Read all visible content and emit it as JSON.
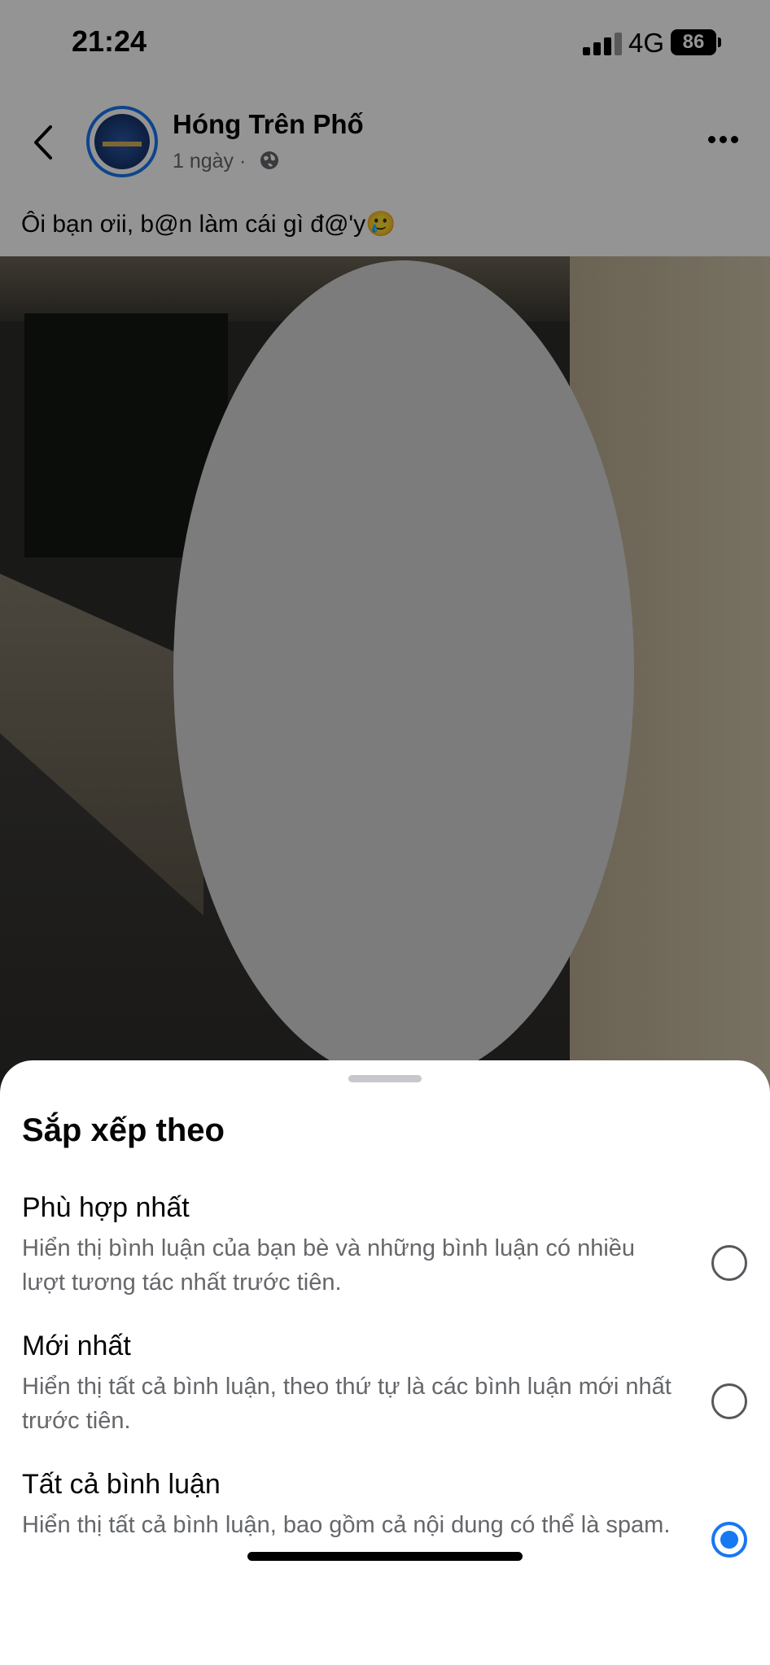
{
  "status_bar": {
    "time": "21:24",
    "network": "4G",
    "battery": "86"
  },
  "post": {
    "page_name": "Hóng Trên Phố",
    "time_ago": "1 ngày",
    "separator": "·",
    "caption": "Ôi bạn ơii, b@n làm cái gì đ@'y🥲"
  },
  "sort_sheet": {
    "title": "Sắp xếp theo",
    "options": [
      {
        "label": "Phù hợp nhất",
        "description": "Hiển thị bình luận của bạn bè và những bình luận có nhiều lượt tương tác nhất trước tiên.",
        "selected": false
      },
      {
        "label": "Mới nhất",
        "description": "Hiển thị tất cả bình luận, theo thứ tự là các bình luận mới nhất trước tiên.",
        "selected": false
      },
      {
        "label": "Tất cả bình luận",
        "description": "Hiển thị tất cả bình luận, bao gồm cả nội dung có thể là spam.",
        "selected": true
      }
    ]
  },
  "colors": {
    "accent": "#1877f2",
    "secondary_text": "#65676b"
  }
}
